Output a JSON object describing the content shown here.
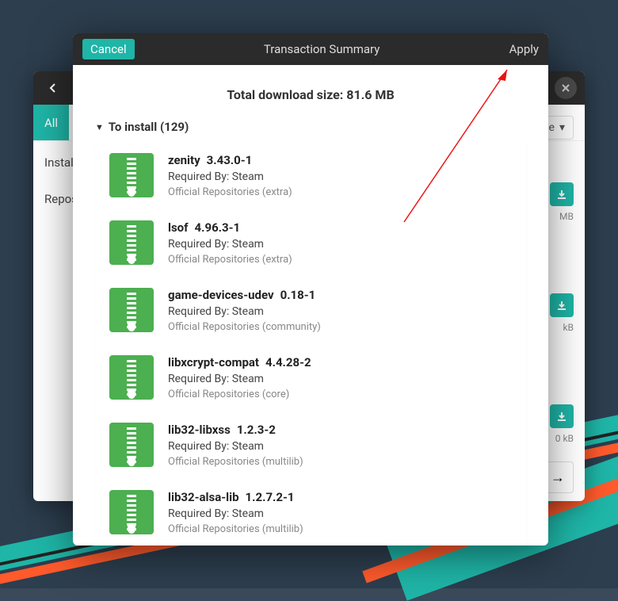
{
  "background": {
    "colors": {
      "teal": "#1fb5a7",
      "yellow": "#ffc739",
      "orange": "#ff5a2c",
      "dark": "#2b2b2b"
    }
  },
  "main_window": {
    "tab_all": "All",
    "sidebar": {
      "installed": "Install",
      "repos": "Repos"
    },
    "source_label": "ce",
    "cards": [
      {
        "size": "MB"
      },
      {
        "size": "kB"
      },
      {
        "size": "0 kB"
      }
    ]
  },
  "modal": {
    "cancel": "Cancel",
    "title": "Transaction Summary",
    "apply": "Apply",
    "download_size": "Total download size: 81.6 MB",
    "section": "To install (129)",
    "packages": [
      {
        "name": "zenity",
        "version": "3.43.0-1",
        "required_by": "Required By: Steam",
        "repo": "Official Repositories (extra)"
      },
      {
        "name": "lsof",
        "version": "4.96.3-1",
        "required_by": "Required By: Steam",
        "repo": "Official Repositories (extra)"
      },
      {
        "name": "game-devices-udev",
        "version": "0.18-1",
        "required_by": "Required By: Steam",
        "repo": "Official Repositories (community)"
      },
      {
        "name": "libxcrypt-compat",
        "version": "4.4.28-2",
        "required_by": "Required By: Steam",
        "repo": "Official Repositories (core)"
      },
      {
        "name": "lib32-libxss",
        "version": "1.2.3-2",
        "required_by": "Required By: Steam",
        "repo": "Official Repositories (multilib)"
      },
      {
        "name": "lib32-alsa-lib",
        "version": "1.2.7.2-1",
        "required_by": "Required By: Steam",
        "repo": "Official Repositories (multilib)"
      }
    ]
  }
}
